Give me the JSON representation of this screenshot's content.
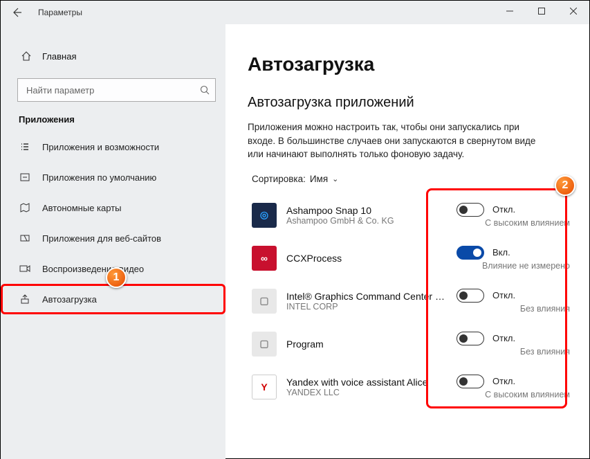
{
  "window": {
    "title": "Параметры"
  },
  "sidebar": {
    "home_label": "Главная",
    "search_placeholder": "Найти параметр",
    "category": "Приложения",
    "items": [
      {
        "label": "Приложения и возможности"
      },
      {
        "label": "Приложения по умолчанию"
      },
      {
        "label": "Автономные карты"
      },
      {
        "label": "Приложения для веб-сайтов"
      },
      {
        "label": "Воспроизведение видео"
      },
      {
        "label": "Автозагрузка"
      }
    ]
  },
  "main": {
    "title": "Автозагрузка",
    "section_title": "Автозагрузка приложений",
    "description": "Приложения можно настроить так, чтобы они запускались при входе. В большинстве случаев они запускаются в свернутом виде или начинают выполнять только фоновую задачу.",
    "sort_label": "Сортировка:",
    "sort_value": "Имя",
    "status_on": "Вкл.",
    "status_off": "Откл.",
    "apps": [
      {
        "name": "Ashampoo Snap 10",
        "publisher": "Ashampoo GmbH & Co. KG",
        "on": false,
        "impact": "С высоким влиянием",
        "iconBg": "#1a2a4a",
        "iconFg": "#2aa0ff",
        "iconChar": "◎"
      },
      {
        "name": "CCXProcess",
        "publisher": "",
        "on": true,
        "impact": "Влияние не измерено",
        "iconBg": "#c8102e",
        "iconFg": "#ffffff",
        "iconChar": "∞"
      },
      {
        "name": "Intel® Graphics Command Center Startup Task",
        "publisher": "INTEL CORP",
        "on": false,
        "impact": "Без влияния",
        "iconBg": "#e8e8e8",
        "iconFg": "#888888",
        "iconChar": "▢"
      },
      {
        "name": "Program",
        "publisher": "",
        "on": false,
        "impact": "Без влияния",
        "iconBg": "#e8e8e8",
        "iconFg": "#888888",
        "iconChar": "▢"
      },
      {
        "name": "Yandex with voice assistant Alice",
        "publisher": "YANDEX LLC",
        "on": false,
        "impact": "С высоким влиянием",
        "iconBg": "#ffffff",
        "iconFg": "#d00000",
        "iconChar": "Y"
      }
    ]
  },
  "markers": {
    "one": "1",
    "two": "2"
  }
}
